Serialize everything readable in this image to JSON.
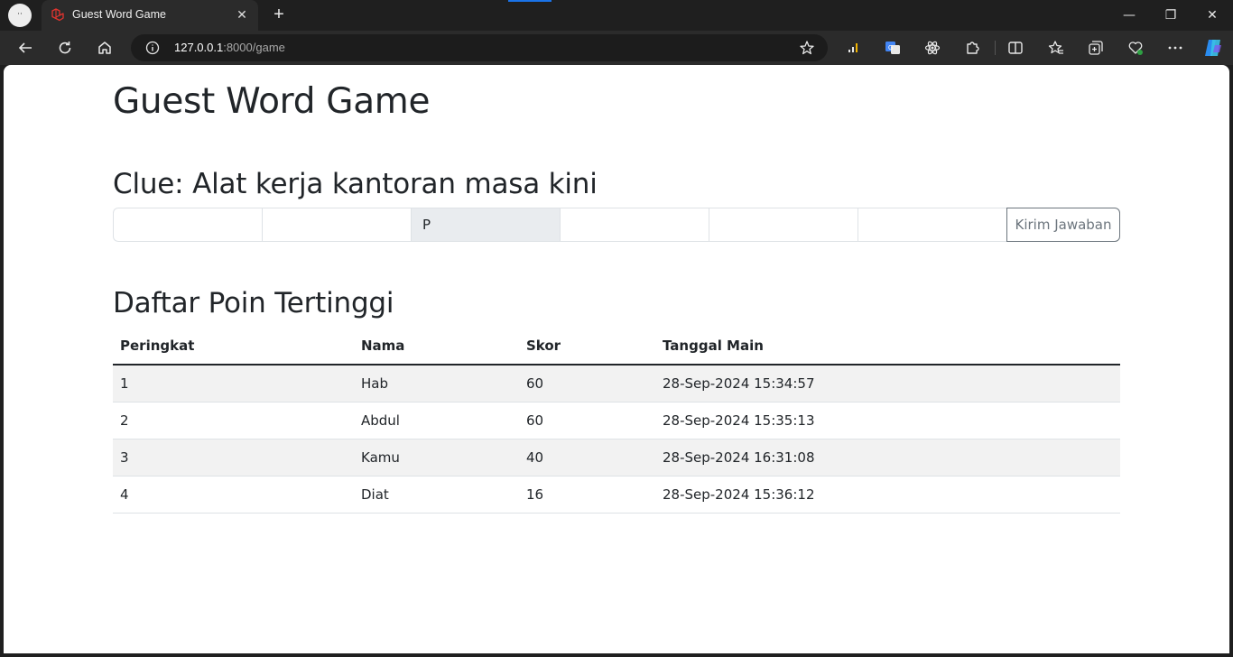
{
  "browser": {
    "profile_label": "··",
    "tab_title": "Guest Word Game",
    "url_host": "127.0.0.1",
    "url_rest": ":8000/game"
  },
  "page": {
    "heading": "Guest Word Game",
    "clue": "Clue: Alat kerja kantoran masa kini",
    "letters": [
      "",
      "",
      "P",
      "",
      "",
      ""
    ],
    "submit_label": "Kirim Jawaban",
    "leaderboard_title": "Daftar Poin Tertinggi",
    "table": {
      "headers": [
        "Peringkat",
        "Nama",
        "Skor",
        "Tanggal Main"
      ],
      "rows": [
        [
          "1",
          "Hab",
          "60",
          "28-Sep-2024 15:34:57"
        ],
        [
          "2",
          "Abdul",
          "60",
          "28-Sep-2024 15:35:13"
        ],
        [
          "3",
          "Kamu",
          "40",
          "28-Sep-2024 16:31:08"
        ],
        [
          "4",
          "Diat",
          "16",
          "28-Sep-2024 15:36:12"
        ]
      ]
    }
  },
  "colors": {
    "accent": "#1a73e8",
    "laravel_red": "#e3342f"
  }
}
